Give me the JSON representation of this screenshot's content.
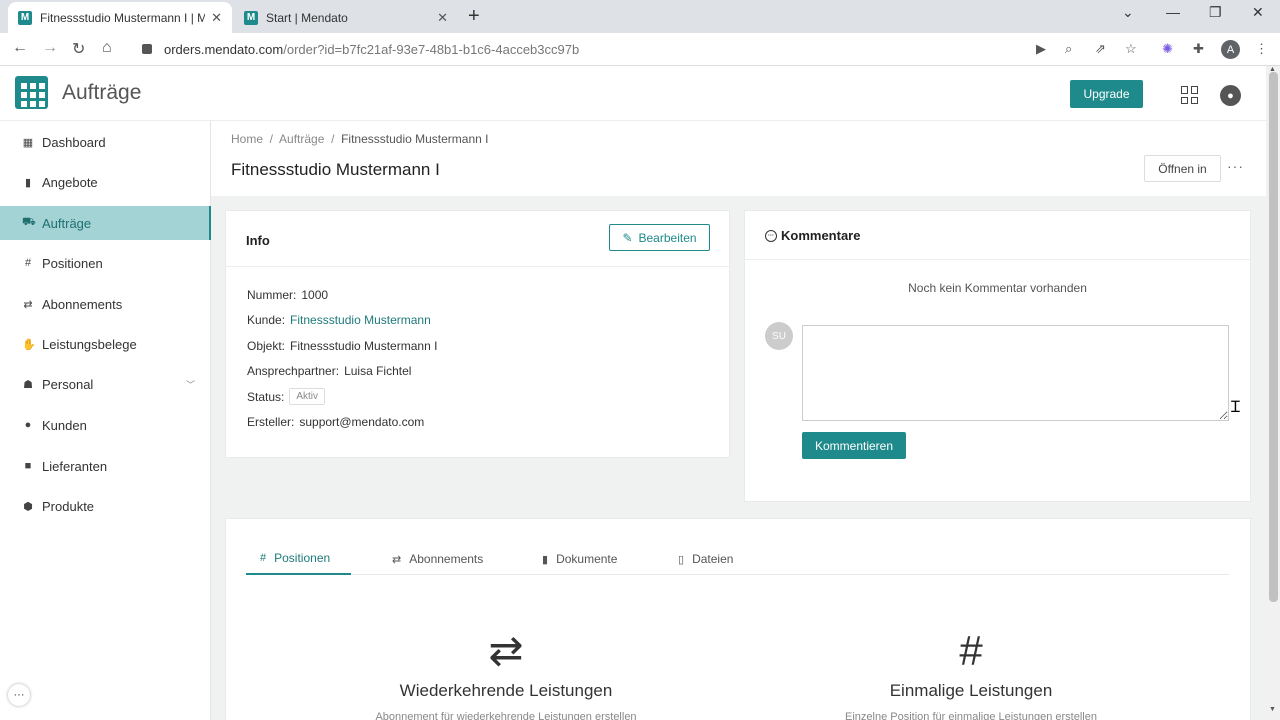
{
  "browser": {
    "tabs": [
      {
        "title": "Fitnessstudio Mustermann I | Me",
        "favicon": "M",
        "active": true
      },
      {
        "title": "Start | Mendato",
        "favicon": "M",
        "active": false
      }
    ],
    "url_host": "orders.mendato.com",
    "url_path": "/order?id=b7fc21af-93e7-48b1-b1c6-4acceb3cc97b",
    "profile_initial": "A"
  },
  "app": {
    "title": "Aufträge",
    "upgrade_label": "Upgrade",
    "accent_color": "#1f8a8c"
  },
  "sidebar": {
    "items": [
      {
        "label": "Dashboard",
        "icon": "dashboard-icon"
      },
      {
        "label": "Angebote",
        "icon": "document-icon"
      },
      {
        "label": "Aufträge",
        "icon": "cart-icon",
        "active": true
      },
      {
        "label": "Positionen",
        "icon": "hash-icon"
      },
      {
        "label": "Abonnements",
        "icon": "repeat-icon"
      },
      {
        "label": "Leistungsbelege",
        "icon": "handshake-icon"
      },
      {
        "label": "Personal",
        "icon": "people-icon",
        "expandable": true
      },
      {
        "label": "Kunden",
        "icon": "person-icon"
      },
      {
        "label": "Lieferanten",
        "icon": "truck-icon"
      },
      {
        "label": "Produkte",
        "icon": "box-icon"
      }
    ]
  },
  "page": {
    "breadcrumb": [
      "Home",
      "Aufträge",
      "Fitnessstudio Mustermann I"
    ],
    "title": "Fitnessstudio Mustermann I",
    "open_in_label": "Öffnen in",
    "more_label": "···"
  },
  "info": {
    "title": "Info",
    "edit_label": "Bearbeiten",
    "rows": [
      {
        "label": "Nummer:",
        "value": "1000"
      },
      {
        "label": "Kunde:",
        "value": "Fitnessstudio Mustermann"
      },
      {
        "label": "Objekt:",
        "value": "Fitnessstudio Mustermann I"
      },
      {
        "label": "Ansprechpartner:",
        "value": "Luisa Fichtel"
      },
      {
        "label": "Status:",
        "value": "Aktiv"
      },
      {
        "label": "Ersteller:",
        "value": "support@mendato.com"
      }
    ]
  },
  "comments": {
    "title": "Kommentare",
    "empty_text": "Noch kein Kommentar vorhanden",
    "avatar_initials": "SU",
    "input_value": "",
    "submit_label": "Kommentieren"
  },
  "tabs": [
    {
      "label": "Positionen",
      "active": true
    },
    {
      "label": "Abonnements"
    },
    {
      "label": "Dokumente"
    },
    {
      "label": "Dateien"
    }
  ],
  "features": [
    {
      "title": "Wiederkehrende Leistungen",
      "subtitle": "Abonnement für wiederkehrende Leistungen erstellen",
      "icon": "repeat-icon"
    },
    {
      "title": "Einmalige Leistungen",
      "subtitle": "Einzelne Position für einmalige Leistungen erstellen",
      "icon": "hash-icon"
    }
  ]
}
